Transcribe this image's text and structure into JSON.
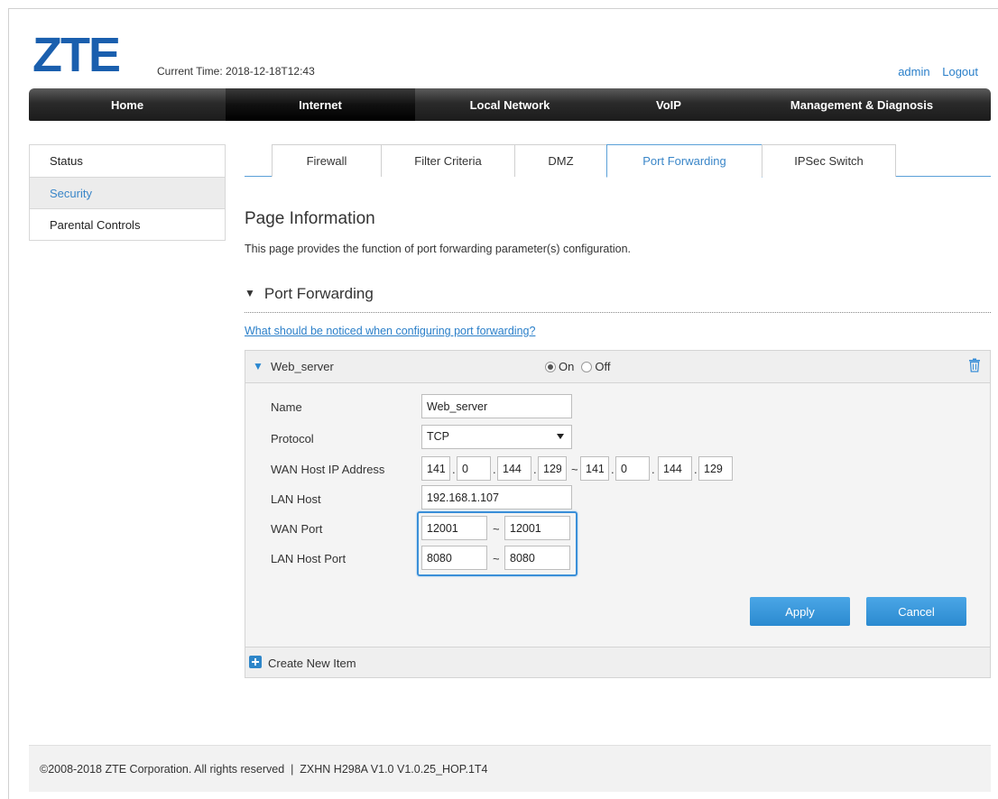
{
  "header": {
    "logo": "ZTE",
    "current_time": "Current Time: 2018-12-18T12:43",
    "user": "admin",
    "logout": "Logout"
  },
  "nav": {
    "items": [
      "Home",
      "Internet",
      "Local Network",
      "VoIP",
      "Management & Diagnosis"
    ],
    "active": "Internet"
  },
  "sidebar": {
    "items": [
      "Status",
      "Security",
      "Parental Controls"
    ],
    "active": "Security"
  },
  "tabs": {
    "items": [
      "Firewall",
      "Filter Criteria",
      "DMZ",
      "Port Forwarding",
      "IPSec Switch"
    ],
    "active": "Port Forwarding"
  },
  "page": {
    "title": "Page Information",
    "description": "This page provides the function of port forwarding parameter(s) configuration.",
    "section_title": "Port Forwarding",
    "notice_link": "What should be noticed when configuring port forwarding?"
  },
  "rule": {
    "name": "Web_server",
    "on_label": "On",
    "off_label": "Off",
    "state": "On",
    "labels": {
      "name": "Name",
      "protocol": "Protocol",
      "wan_host_ip": "WAN Host IP Address",
      "lan_host": "LAN Host",
      "wan_port": "WAN Port",
      "lan_host_port": "LAN Host Port"
    },
    "values": {
      "name": "Web_server",
      "protocol": "TCP",
      "wan_ip_start": [
        "141",
        "0",
        "144",
        "129"
      ],
      "wan_ip_end": [
        "141",
        "0",
        "144",
        "129"
      ],
      "lan_host": "192.168.1.107",
      "wan_port_start": "12001",
      "wan_port_end": "12001",
      "lan_port_start": "8080",
      "lan_port_end": "8080"
    },
    "separator": "~",
    "apply": "Apply",
    "cancel": "Cancel",
    "create_new": "Create New Item"
  },
  "footer": {
    "text": "©2008-2018 ZTE Corporation. All rights reserved  |  ZXHN H298A V1.0 V1.0.25_HOP.1T4"
  }
}
